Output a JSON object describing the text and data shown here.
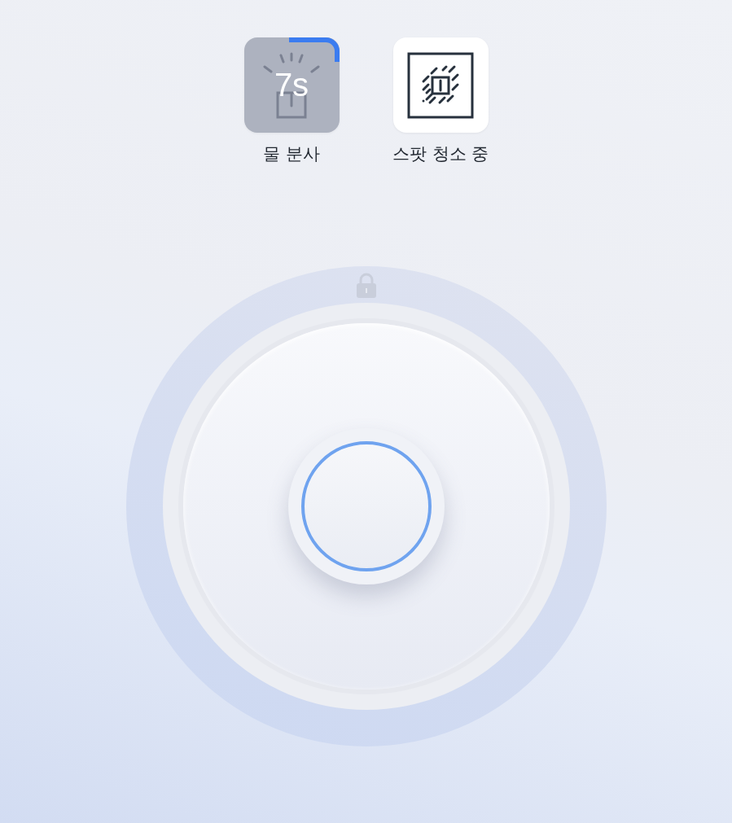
{
  "modes": [
    {
      "kind": "spray",
      "label": "물 분사",
      "active": false,
      "countdown": "7s"
    },
    {
      "kind": "spot",
      "label": "스팟 청소 중",
      "active": true
    }
  ],
  "dial": {
    "locked": true
  }
}
